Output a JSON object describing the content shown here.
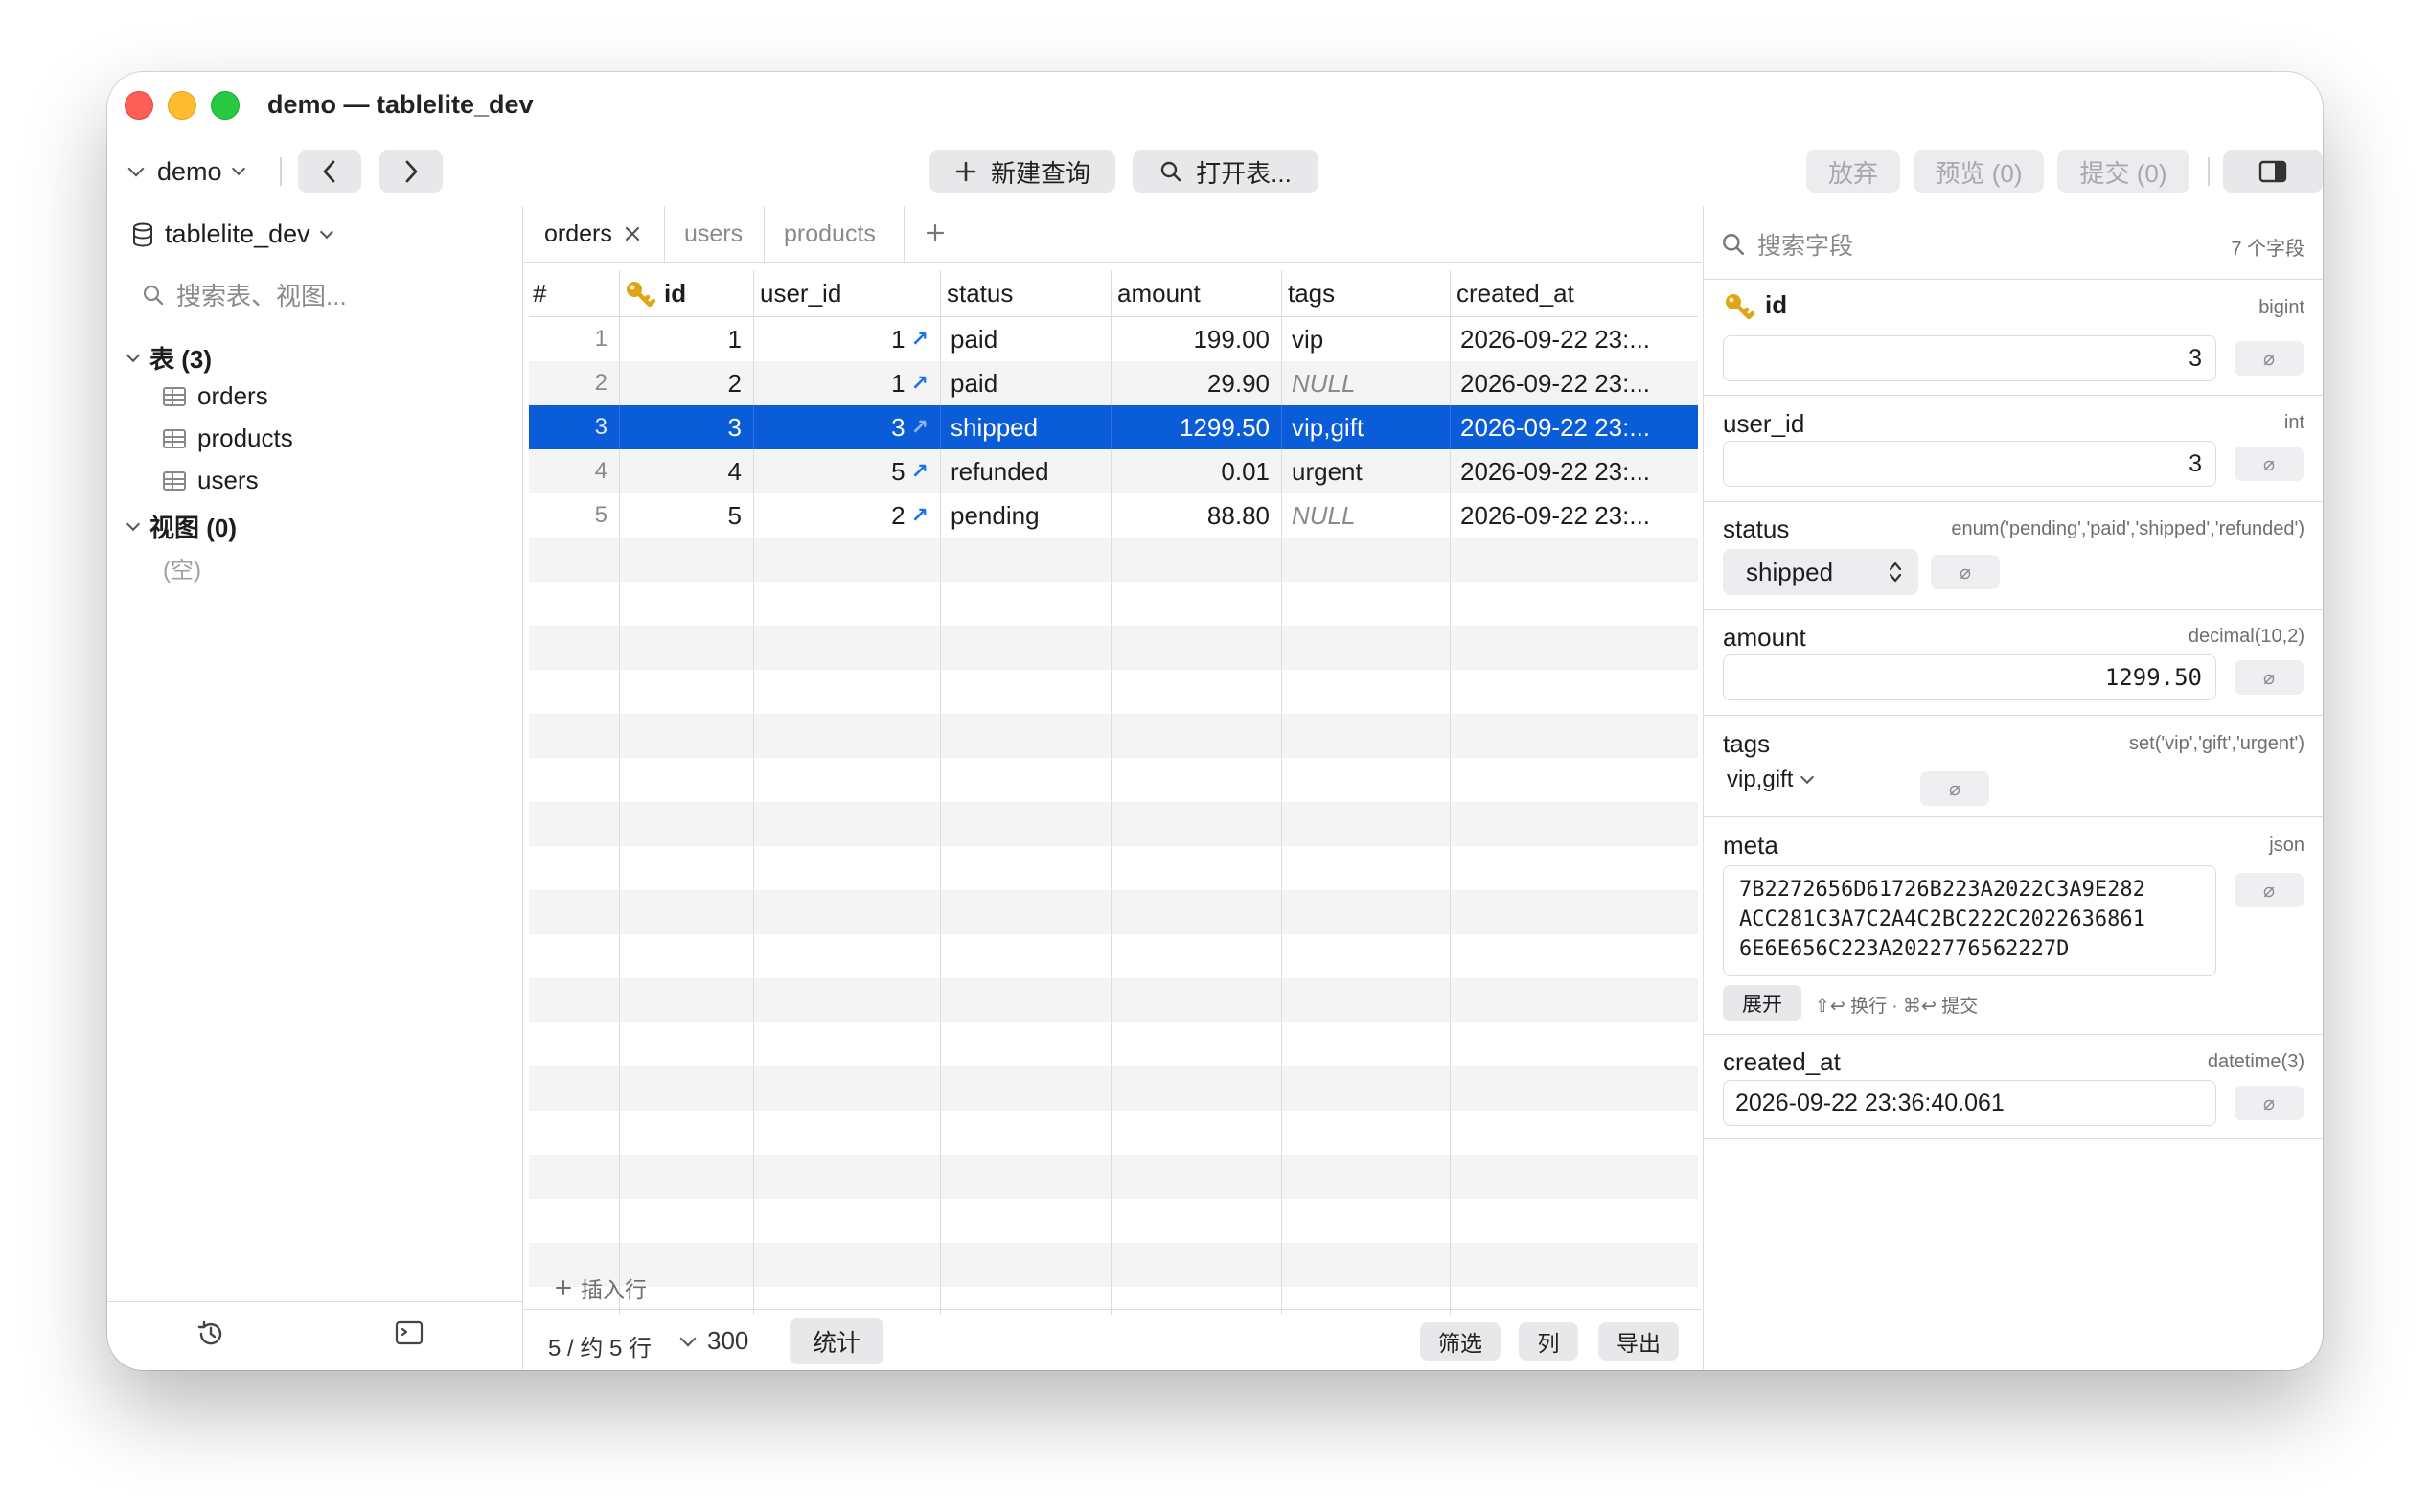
{
  "window": {
    "title": "demo — tablelite_dev"
  },
  "toolbar": {
    "connection": "demo",
    "new_query": "新建查询",
    "open_table": "打开表...",
    "discard": "放弃",
    "preview": "预览 (0)",
    "commit": "提交 (0)"
  },
  "sidebar": {
    "database": "tablelite_dev",
    "search_placeholder": "搜索表、视图...",
    "tables_header": "表 (3)",
    "tables": [
      "orders",
      "products",
      "users"
    ],
    "views_header": "视图 (0)",
    "views_empty": "(空)"
  },
  "tabs": [
    {
      "label": "orders",
      "active": true
    },
    {
      "label": "users",
      "active": false
    },
    {
      "label": "products",
      "active": false
    }
  ],
  "grid": {
    "columns": [
      "#",
      "id",
      "user_id",
      "status",
      "amount",
      "tags",
      "created_at"
    ],
    "rows": [
      {
        "num": "1",
        "id": "1",
        "user_id": "1",
        "status": "paid",
        "amount": "199.00",
        "tags": "vip",
        "created_at": "2026-09-22 23:..."
      },
      {
        "num": "2",
        "id": "2",
        "user_id": "1",
        "status": "paid",
        "amount": "29.90",
        "tags": "NULL",
        "created_at": "2026-09-22 23:..."
      },
      {
        "num": "3",
        "id": "3",
        "user_id": "3",
        "status": "shipped",
        "amount": "1299.50",
        "tags": "vip,gift",
        "created_at": "2026-09-22 23:..."
      },
      {
        "num": "4",
        "id": "4",
        "user_id": "5",
        "status": "refunded",
        "amount": "0.01",
        "tags": "urgent",
        "created_at": "2026-09-22 23:..."
      },
      {
        "num": "5",
        "id": "5",
        "user_id": "2",
        "status": "pending",
        "amount": "88.80",
        "tags": "NULL",
        "created_at": "2026-09-22 23:..."
      }
    ],
    "selected_row": 3,
    "insert_row": "插入行"
  },
  "footer": {
    "row_count": "5 / 约 5 行",
    "limit": "300",
    "stats": "统计",
    "filter": "筛选",
    "columns": "列",
    "export": "导出"
  },
  "inspector": {
    "search_placeholder": "搜索字段",
    "field_count": "7 个字段",
    "null_symbol": "⌀",
    "fields": {
      "id": {
        "name": "id",
        "type": "bigint",
        "value": "3"
      },
      "user_id": {
        "name": "user_id",
        "type": "int",
        "value": "3"
      },
      "status": {
        "name": "status",
        "type": "enum('pending','paid','shipped','refunded')",
        "value": "shipped"
      },
      "amount": {
        "name": "amount",
        "type": "decimal(10,2)",
        "value": "1299.50"
      },
      "tags": {
        "name": "tags",
        "type": "set('vip','gift','urgent')",
        "value": "vip,gift"
      },
      "meta": {
        "name": "meta",
        "type": "json",
        "value_lines": [
          "7B2272656D61726B223A2022C3A9E282",
          "ACC281C3A7C2A4C2BC222C2022636861",
          "6E6E656C223A2022776562227D"
        ],
        "expand": "展开",
        "hint": "⇧↩ 换行 · ⌘↩ 提交"
      },
      "created_at": {
        "name": "created_at",
        "type": "datetime(3)",
        "value": "2026-09-22 23:36:40.061"
      }
    }
  }
}
